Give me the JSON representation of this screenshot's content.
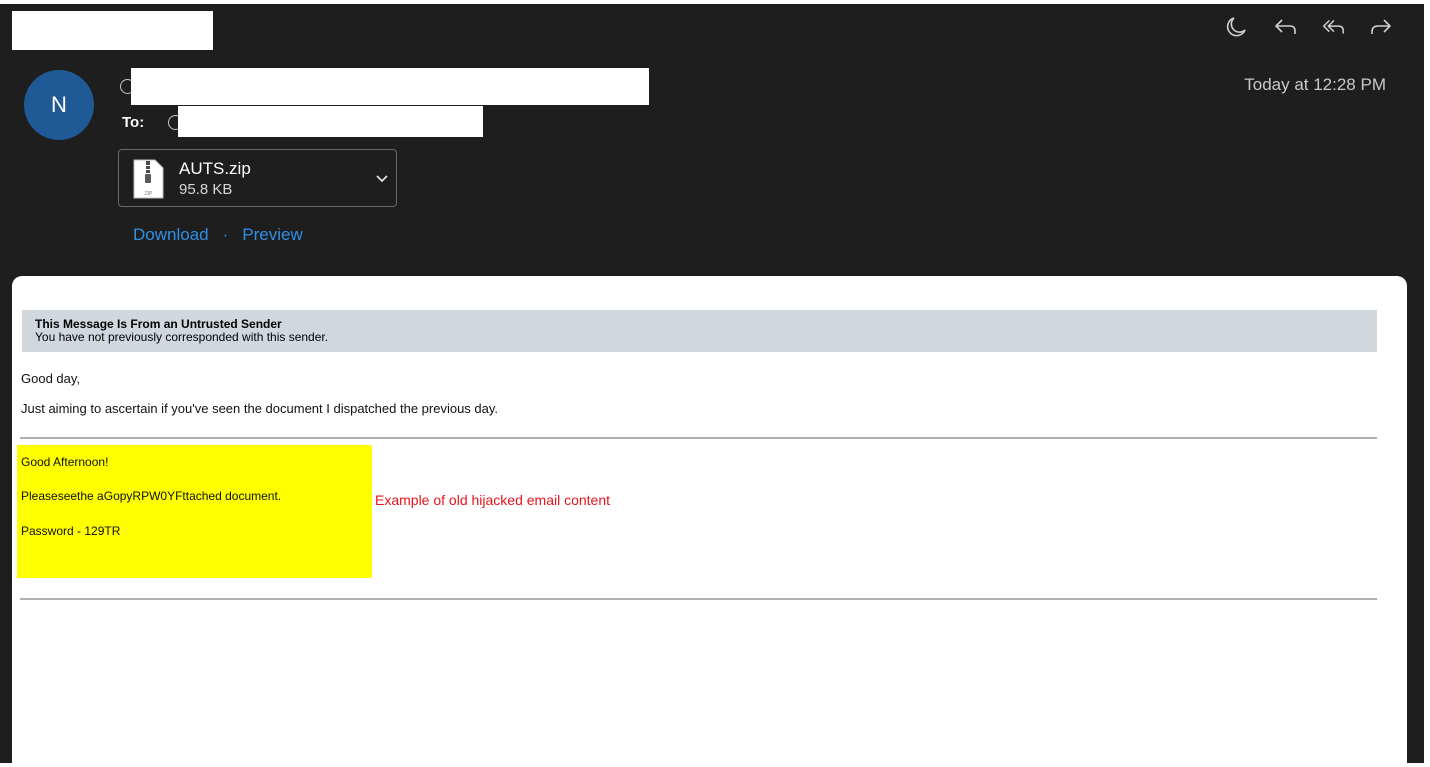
{
  "toolbar": {
    "icons": [
      "moon-icon",
      "reply-icon",
      "reply-all-icon",
      "forward-icon"
    ]
  },
  "header": {
    "avatar_initial": "N",
    "to_label": "To:",
    "timestamp": "Today at 12:28 PM"
  },
  "attachment": {
    "file_name": "AUTS.zip",
    "file_size": "95.8 KB",
    "icon_label": "ZIP",
    "download_label": "Download",
    "separator": "·",
    "preview_label": "Preview"
  },
  "banner": {
    "title": "This Message Is From an Untrusted Sender",
    "subtitle": "You have not previously corresponded with this sender."
  },
  "message": {
    "greeting": "Good day,",
    "line1": "Just aiming to ascertain if you've seen the document I dispatched the previous day."
  },
  "quoted": {
    "greeting": "Good Afternoon!",
    "line1": "Pleaseseethe aGopyRPW0YFttached document.",
    "line2": "Password - 129TR"
  },
  "annotation": {
    "note": "Example of old hijacked email content"
  },
  "colors": {
    "window_bg": "#1e1e1e",
    "avatar": "#1f5a96",
    "link": "#2f8fe6",
    "banner_bg": "#d0d8de",
    "highlight": "#ffff00",
    "annotation": "#e8141c"
  }
}
